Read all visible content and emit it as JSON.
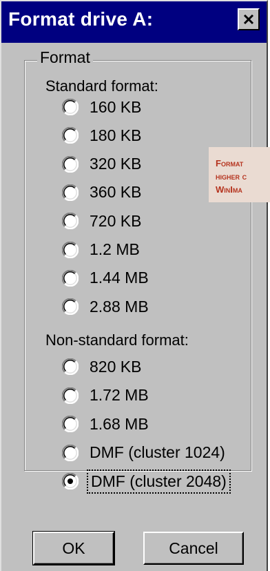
{
  "window": {
    "title": "Format drive A:",
    "close_glyph": "✕"
  },
  "group": {
    "legend": "Format",
    "standard_label": "Standard format:",
    "nonstandard_label": "Non-standard format:"
  },
  "standard_options": [
    {
      "label": "160 KB",
      "selected": false
    },
    {
      "label": "180 KB",
      "selected": false
    },
    {
      "label": "320 KB",
      "selected": false
    },
    {
      "label": "360 KB",
      "selected": false
    },
    {
      "label": "720 KB",
      "selected": false
    },
    {
      "label": "1.2 MB",
      "selected": false
    },
    {
      "label": "1.44 MB",
      "selected": false
    },
    {
      "label": "2.88 MB",
      "selected": false
    }
  ],
  "nonstandard_options": [
    {
      "label": "820 KB",
      "selected": false
    },
    {
      "label": "1.72 MB",
      "selected": false
    },
    {
      "label": "1.68 MB",
      "selected": false
    },
    {
      "label": "DMF (cluster 1024)",
      "selected": false
    },
    {
      "label": "DMF (cluster 2048)",
      "selected": true
    }
  ],
  "buttons": {
    "ok": "OK",
    "cancel": "Cancel"
  },
  "caption": {
    "line1": "Format",
    "line2": "higher c",
    "line3": "WinIma"
  },
  "colors": {
    "titlebar": "#000080",
    "face": "#c0c0c0",
    "caption_bg": "#eadbd2",
    "caption_text": "#b5331e"
  }
}
